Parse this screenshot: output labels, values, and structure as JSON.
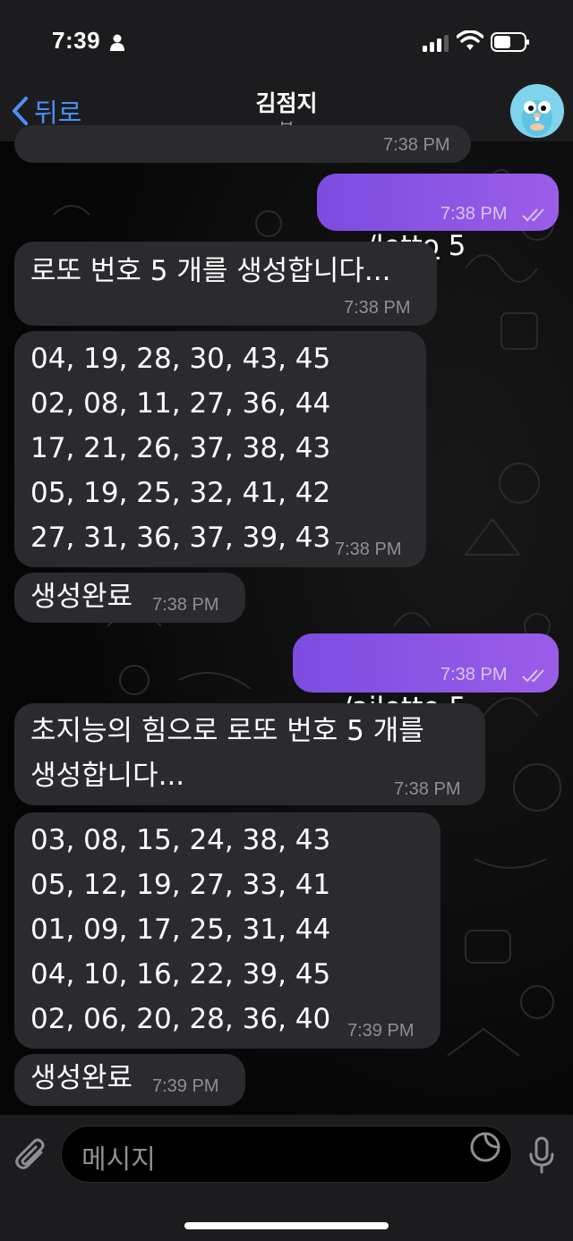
{
  "status_bar": {
    "time": "7:39"
  },
  "header": {
    "back_label": "뒤로",
    "title": "김점지",
    "subtitle": "봇"
  },
  "messages": [
    {
      "dir": "in",
      "time": "7:38 PM"
    },
    {
      "dir": "out",
      "command": "/lotto",
      "arg": " 5",
      "time": "7:38 PM"
    },
    {
      "dir": "in",
      "text": "로또 번호 5 개를 생성합니다...",
      "time": "7:38 PM"
    },
    {
      "dir": "in",
      "lines": [
        "04, 19, 28, 30, 43, 45",
        "02, 08, 11, 27, 36, 44",
        "17, 21, 26, 37, 38, 43",
        "05, 19, 25, 32, 41, 42",
        "27, 31, 36, 37, 39, 43"
      ],
      "time": "7:38 PM"
    },
    {
      "dir": "in",
      "text": "생성완료",
      "time": "7:38 PM"
    },
    {
      "dir": "out",
      "command": "/ailotto",
      "arg": " 5",
      "time": "7:38 PM"
    },
    {
      "dir": "in",
      "lines": [
        "초지능의 힘으로 로또 번호 5 개를",
        "생성합니다..."
      ],
      "time": "7:38 PM"
    },
    {
      "dir": "in",
      "lines": [
        "03, 08, 15, 24, 38, 43",
        "05, 12, 19, 27, 33, 41",
        "01, 09, 17, 25, 31, 44",
        "04, 10, 16, 22, 39, 45",
        "02, 06, 20, 28, 36, 40"
      ],
      "time": "7:39 PM"
    },
    {
      "dir": "in",
      "text": "생성완료",
      "time": "7:39 PM"
    }
  ],
  "composer": {
    "placeholder": "메시지"
  },
  "colors": {
    "accent": "#4d8ef7",
    "outgoing_bubble": "#8a55e4",
    "incoming_bubble": "#2b2b2f"
  }
}
